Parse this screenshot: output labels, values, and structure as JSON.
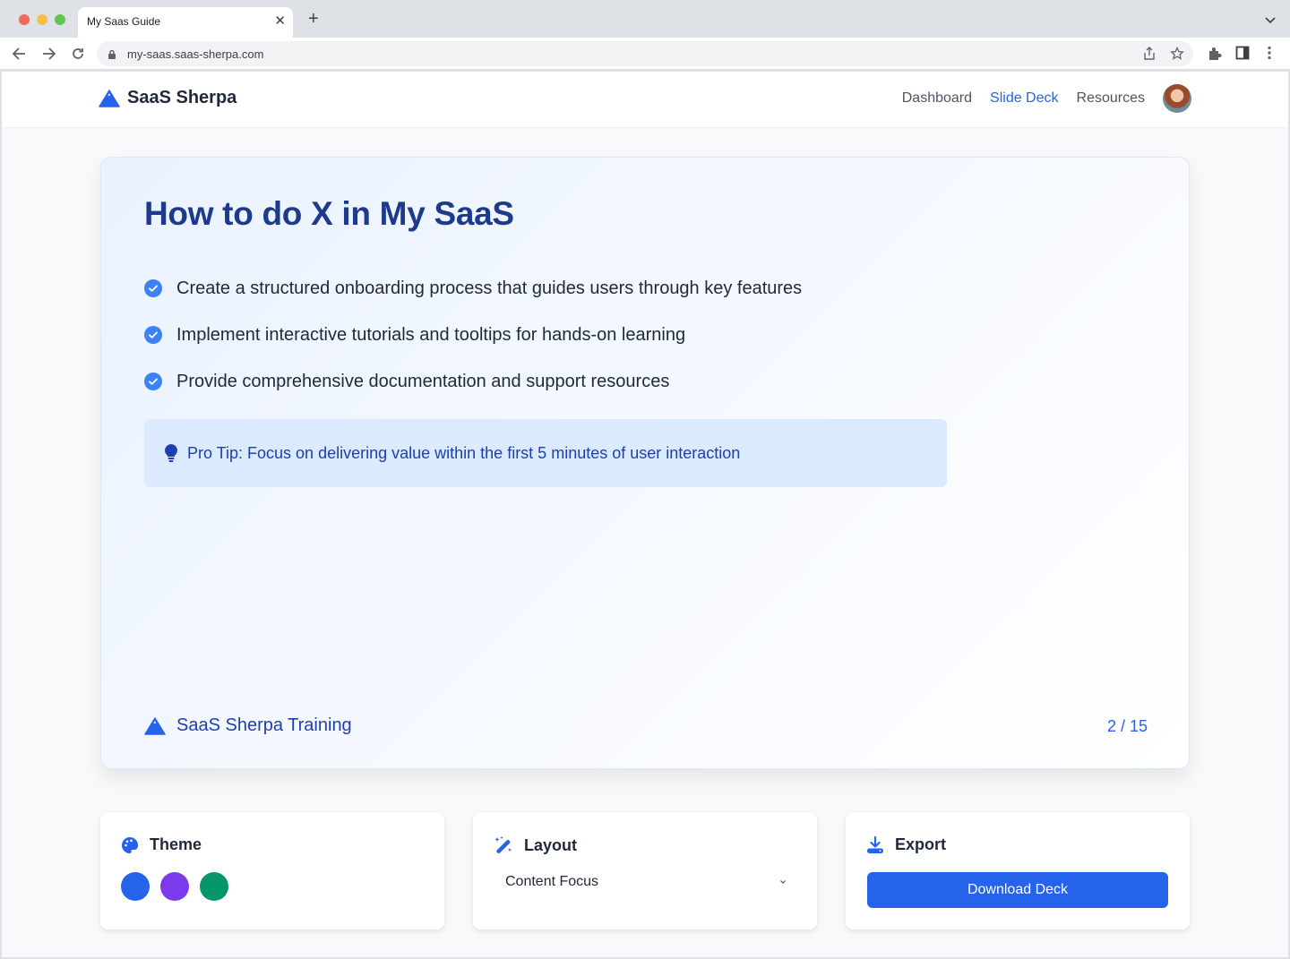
{
  "browser": {
    "tab_title": "My Saas Guide",
    "url": "my-saas.saas-sherpa.com",
    "icons": [
      "back-arrow-icon",
      "forward-arrow-icon",
      "reload-icon",
      "lock-icon",
      "share-icon",
      "star-icon",
      "extensions-icon",
      "sidebar-icon",
      "menu-icon",
      "close-icon",
      "plus-icon",
      "chevron-down-icon"
    ]
  },
  "app": {
    "brand": "SaaS Sherpa",
    "nav": [
      {
        "label": "Dashboard",
        "active": false
      },
      {
        "label": "Slide Deck",
        "active": true
      },
      {
        "label": "Resources",
        "active": false
      }
    ]
  },
  "slide": {
    "title": "How to do X in My SaaS",
    "bullets": [
      "Create a structured onboarding process that guides users through key features",
      "Implement interactive tutorials and tooltips for hands-on learning",
      "Provide comprehensive documentation and support resources"
    ],
    "pro_tip": "Pro Tip: Focus on delivering value within the first 5 minutes of user interaction",
    "footer_brand": "SaaS Sherpa Training",
    "counter": "2 / 15"
  },
  "panels": {
    "theme": {
      "title": "Theme",
      "swatches": [
        "#2563eb",
        "#7c3aed",
        "#059669"
      ]
    },
    "layout": {
      "title": "Layout",
      "selected": "Content Focus"
    },
    "export": {
      "title": "Export",
      "button": "Download Deck"
    }
  },
  "colors": {
    "accent": "#2563eb",
    "title": "#1e3a8a",
    "tip_bg": "#dbeafe",
    "tip_text": "#1e40af"
  }
}
